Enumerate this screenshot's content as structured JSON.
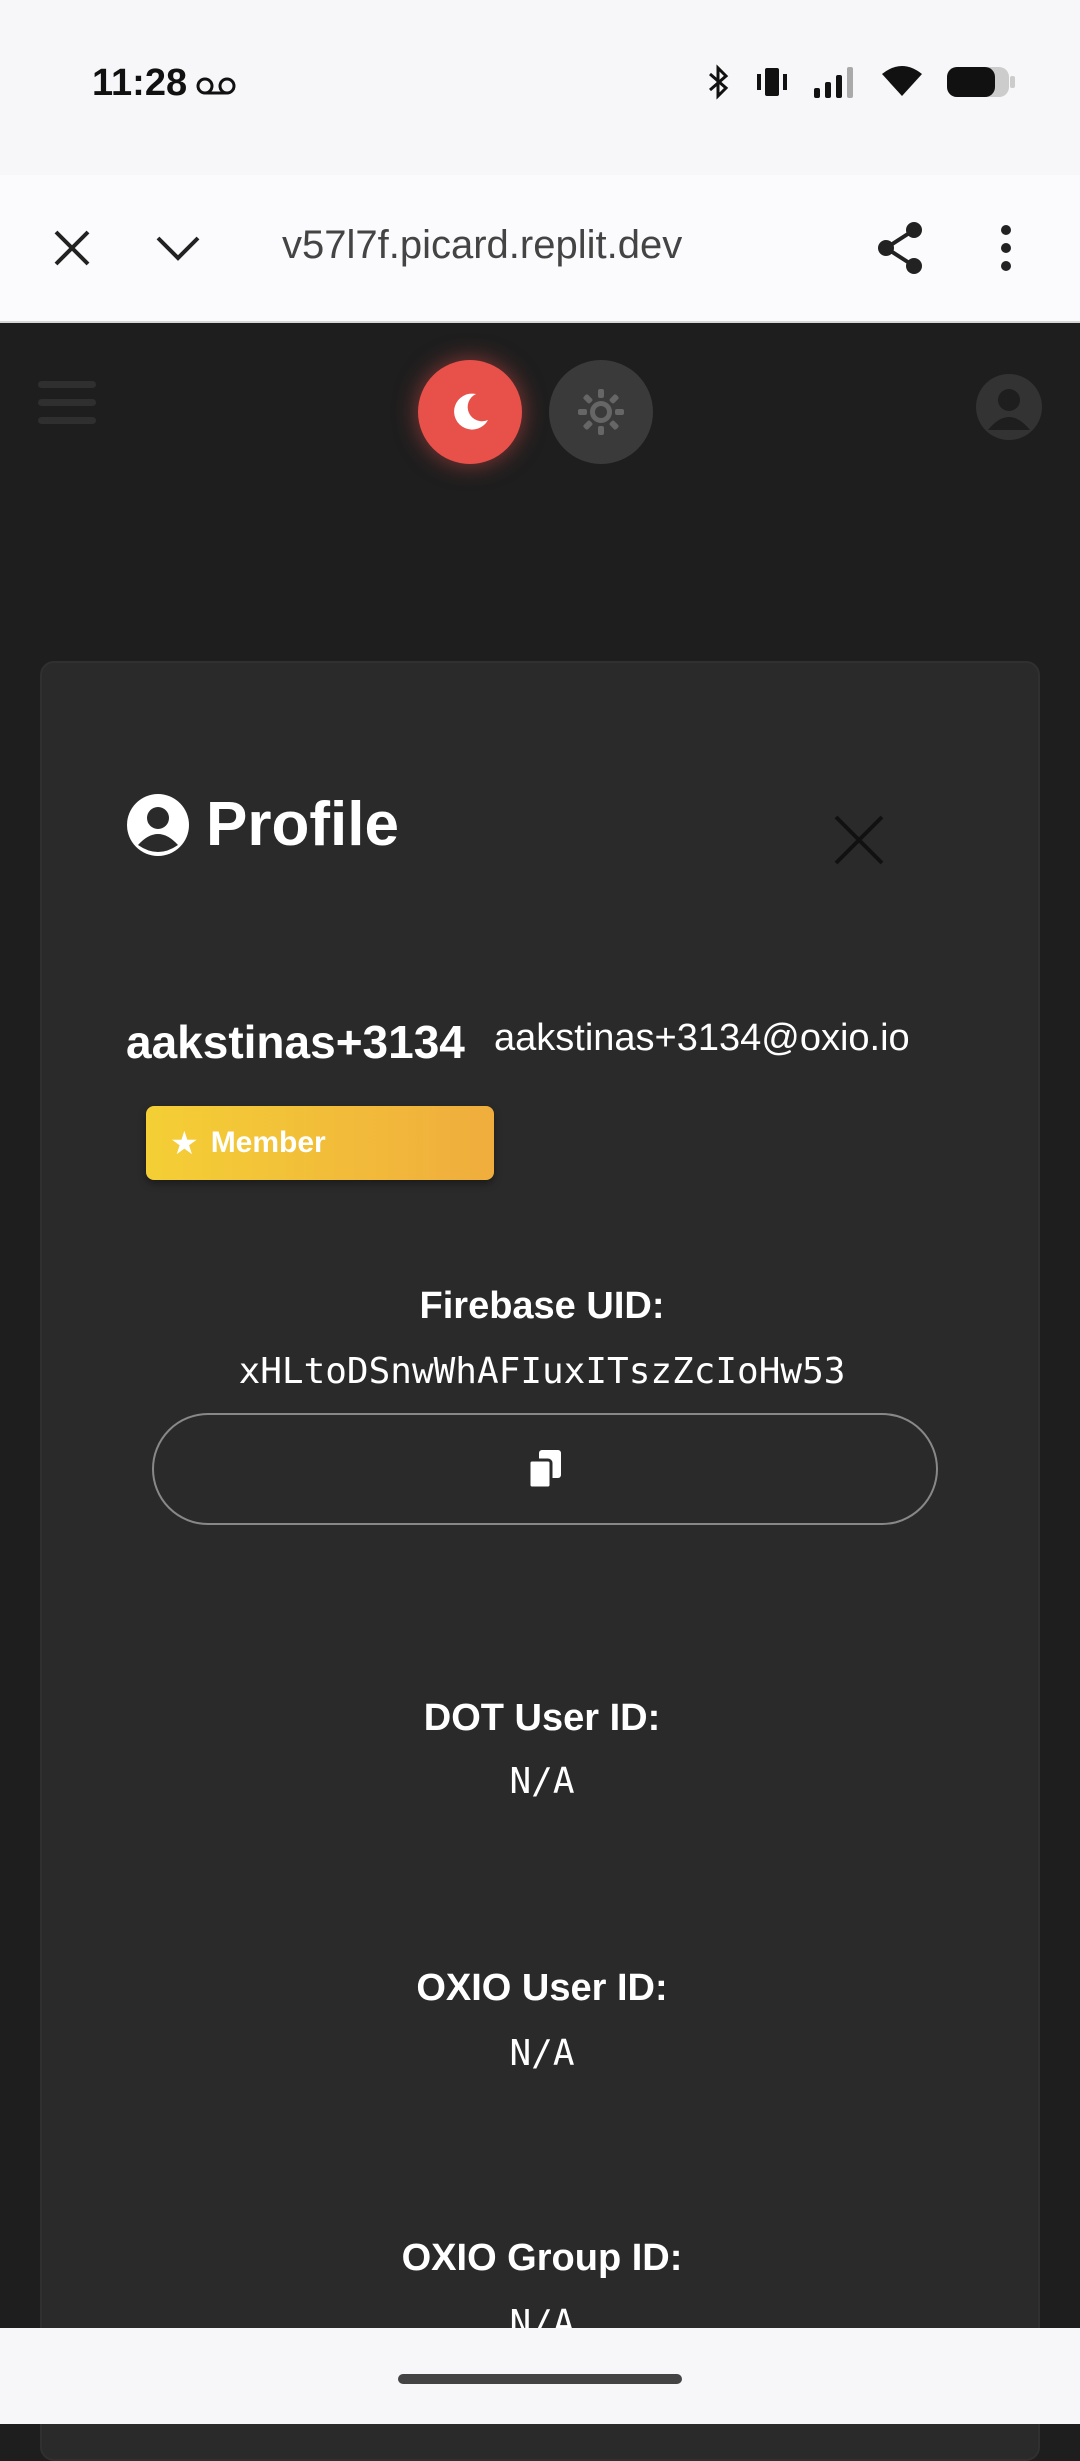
{
  "status_bar": {
    "time": "11:28",
    "icons": [
      "voicemail-icon",
      "bluetooth-icon",
      "vibrate-icon",
      "signal-icon",
      "wifi-icon",
      "battery-icon"
    ]
  },
  "browser": {
    "url": "v57l7f.picard.replit.dev"
  },
  "header": {
    "dark_theme_active": true,
    "accent_color": "#e8504a"
  },
  "profile": {
    "title": "Profile",
    "username": "aakstinas+3134",
    "email": "aakstinas+3134@oxio.io",
    "badge": "Member",
    "badge_star": "★",
    "fields": [
      {
        "label": "Firebase UID:",
        "value": "xHLtoDSnwWhAFIuxITszZcIoHw53"
      },
      {
        "label": "DOT User ID:",
        "value": "N/A"
      },
      {
        "label": "OXIO User ID:",
        "value": "N/A"
      },
      {
        "label": "OXIO Group ID:",
        "value": "N/A"
      }
    ]
  }
}
